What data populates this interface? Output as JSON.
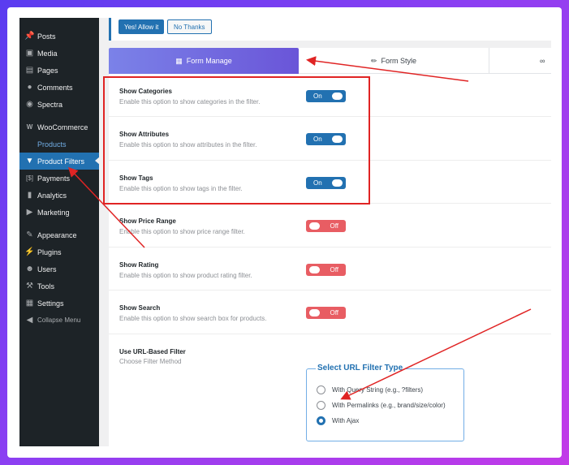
{
  "notice": {
    "allow_label": "Yes! Allow it",
    "deny_label": "No Thanks"
  },
  "sidebar": {
    "items": [
      {
        "label": "Posts",
        "icon": "pin-icon"
      },
      {
        "label": "Media",
        "icon": "media-icon"
      },
      {
        "label": "Pages",
        "icon": "pages-icon"
      },
      {
        "label": "Comments",
        "icon": "comments-icon"
      },
      {
        "label": "Spectra",
        "icon": "spectra-icon"
      },
      {
        "label": "WooCommerce",
        "icon": "woocommerce-icon"
      },
      {
        "label": "Products",
        "icon": ""
      },
      {
        "label": "Product Filters",
        "icon": "filter-icon"
      },
      {
        "label": "Payments",
        "icon": "payments-icon"
      },
      {
        "label": "Analytics",
        "icon": "analytics-icon"
      },
      {
        "label": "Marketing",
        "icon": "megaphone-icon"
      },
      {
        "label": "Appearance",
        "icon": "brush-icon"
      },
      {
        "label": "Plugins",
        "icon": "plugin-icon"
      },
      {
        "label": "Users",
        "icon": "user-icon"
      },
      {
        "label": "Tools",
        "icon": "wrench-icon"
      },
      {
        "label": "Settings",
        "icon": "settings-icon"
      },
      {
        "label": "Collapse Menu",
        "icon": "collapse-icon"
      }
    ]
  },
  "tabs": [
    {
      "label": "Form Manage",
      "icon": "form-icon"
    },
    {
      "label": "Form Style",
      "icon": "pencil-icon"
    }
  ],
  "settings": [
    {
      "title": "Show Categories",
      "desc": "Enable this option to show categories in the filter.",
      "state": "On"
    },
    {
      "title": "Show Attributes",
      "desc": "Enable this option to show attributes in the filter.",
      "state": "On"
    },
    {
      "title": "Show Tags",
      "desc": "Enable this option to show tags in the filter.",
      "state": "On"
    },
    {
      "title": "Show Price Range",
      "desc": "Enable this option to show price range filter.",
      "state": "Off"
    },
    {
      "title": "Show Rating",
      "desc": "Enable this option to show product rating filter.",
      "state": "Off"
    },
    {
      "title": "Show Search",
      "desc": "Enable this option to show search box for products.",
      "state": "Off"
    }
  ],
  "url_filter": {
    "title": "Use URL-Based Filter",
    "desc": "Choose Filter Method",
    "legend": "Select URL Filter Type",
    "options": [
      {
        "label": "With Query String (e.g., ?filters)",
        "checked": false
      },
      {
        "label": "With Permalinks (e.g., brand/size/color)",
        "checked": false
      },
      {
        "label": "With Ajax",
        "checked": true
      }
    ]
  },
  "colors": {
    "accent": "#2271b1",
    "off": "#e85d63",
    "annotation": "#e02424"
  }
}
